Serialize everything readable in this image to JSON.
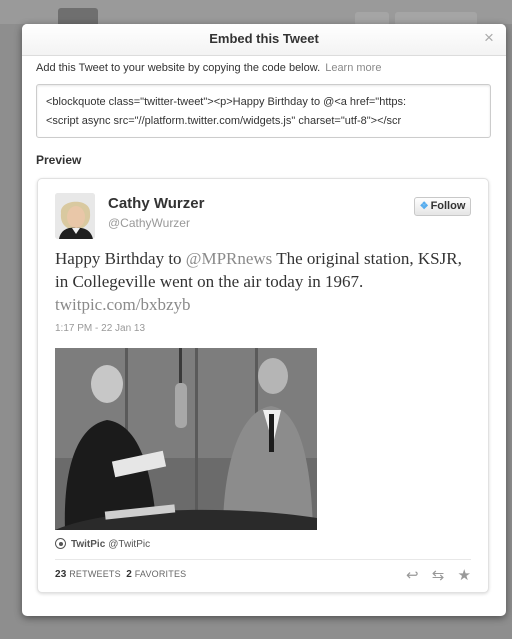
{
  "modal": {
    "title": "Embed this Tweet",
    "close": "×",
    "instructions": "Add this Tweet to your website by copying the code below.",
    "learn_more": "Learn more",
    "code_line1": "<blockquote class=\"twitter-tweet\"><p>Happy Birthday to @<a href=\"https:",
    "code_line2": "<script async src=\"//platform.twitter.com/widgets.js\" charset=\"utf-8\"></scr",
    "preview_label": "Preview"
  },
  "tweet": {
    "name": "Cathy Wurzer",
    "handle": "@CathyWurzer",
    "follow_label": "Follow",
    "text_prefix": "Happy Birthday to ",
    "mention": "@MPRnews",
    "text_body": " The original station, KSJR, in Collegeville went on the air today in 1967. ",
    "link": "twitpic.com/bxbzyb",
    "timestamp": "1:17 PM - 22 Jan 13",
    "attribution_name": "TwitPic",
    "attribution_handle": "@TwitPic",
    "retweets_count": "23",
    "retweets_label": "RETWEETS",
    "favorites_count": "2",
    "favorites_label": "FAVORITES"
  },
  "icons": {
    "reply": "reply-icon",
    "retweet": "retweet-icon",
    "favorite": "star-icon",
    "close": "close-icon",
    "twitter_bird": "bird-icon"
  },
  "colors": {
    "link": "#8a8a8a",
    "bird": "#55acee",
    "backdrop": "#8e8e8e"
  }
}
